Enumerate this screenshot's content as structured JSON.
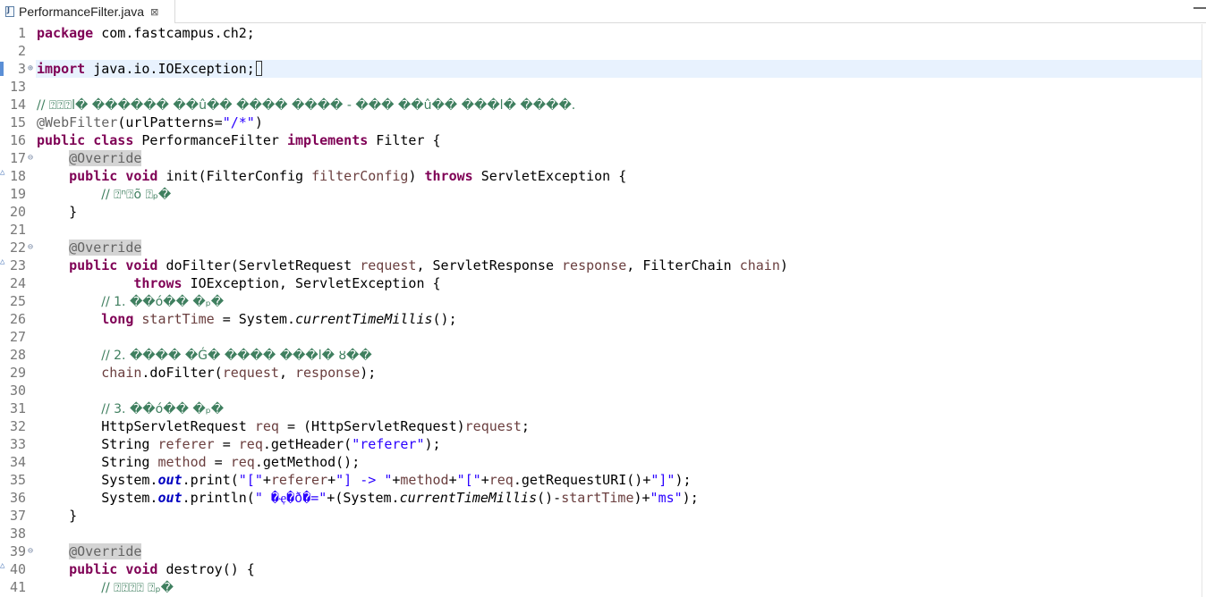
{
  "tab": {
    "title": "PerformanceFilter.java",
    "icon": "java-file-icon",
    "close_glyph": "⊠"
  },
  "colors": {
    "keyword": "#7f0055",
    "string": "#2a00ff",
    "comment": "#3f7f5f",
    "annotation": "#646464",
    "parameter": "#6a3e3e",
    "static_field": "#0000c0",
    "current_line": "#e8f2fe"
  },
  "lines": {
    "n1": "1",
    "n2": "2",
    "n3": "3",
    "n13": "13",
    "n14": "14",
    "n15": "15",
    "n16": "16",
    "n17": "17",
    "n18": "18",
    "n19": "19",
    "n20": "20",
    "n21": "21",
    "n22": "22",
    "n23": "23",
    "n24": "24",
    "n25": "25",
    "n26": "26",
    "n27": "27",
    "n28": "28",
    "n29": "29",
    "n30": "30",
    "n31": "31",
    "n32": "32",
    "n33": "33",
    "n34": "34",
    "n35": "35",
    "n36": "36",
    "n37": "37",
    "n38": "38",
    "n39": "39",
    "n40": "40",
    "n41": "41"
  },
  "code": {
    "l1_kw": "package",
    "l1_rest": " com.fastcampus.ch2;",
    "l3_kw": "import",
    "l3_rest": " java.io.IOException;",
    "l14_comment": "// ⍰⍰⍰l� ������ ��û�� ���� ���� - ��� ��û�� ���l� ����.",
    "l15_ann": "@WebFilter",
    "l15_a": "(urlPatterns=",
    "l15_s": "\"/*\"",
    "l15_b": ")",
    "l16_kw1": "public",
    "l16_kw2": "class",
    "l16_name": " PerformanceFilter ",
    "l16_kw3": "implements",
    "l16_rest": " Filter {",
    "override": "@Override",
    "l18_kw1": "public",
    "l18_kw2": "void",
    "l18_a": " init(FilterConfig ",
    "l18_p": "filterConfig",
    "l18_b": ") ",
    "l18_kw3": "throws",
    "l18_c": " ServletException {",
    "l19_comment": "// ⍰ⁿ⍰õ ⍰ₚ�",
    "close_brace": "}",
    "l23_kw1": "public",
    "l23_kw2": "void",
    "l23_a": " doFilter(ServletRequest ",
    "l23_p1": "request",
    "l23_b": ", ServletResponse ",
    "l23_p2": "response",
    "l23_c": ", FilterChain ",
    "l23_p3": "chain",
    "l23_d": ")",
    "l24_kw": "throws",
    "l24_rest": " IOException, ServletException {",
    "l25_comment": "// 1. ��ó�� �ₚ�",
    "l26_kw": "long",
    "l26_var": "startTime",
    "l26_a": " = System.",
    "l26_m": "currentTimeMillis",
    "l26_b": "();",
    "l28_comment": "// 2. ���� �Ǵ� ���� ���l� ȣ��",
    "l29_p1": "chain",
    "l29_a": ".doFilter(",
    "l29_p2": "request",
    "l29_b": ", ",
    "l29_p3": "response",
    "l29_c": ");",
    "l31_comment": "// 3. ��ó�� �ₚ�",
    "l32_a": "HttpServletRequest ",
    "l32_v": "req",
    "l32_b": " = (HttpServletRequest)",
    "l32_p": "request",
    "l32_c": ";",
    "l33_a": "String ",
    "l33_v": "referer",
    "l33_b": " = ",
    "l33_v2": "req",
    "l33_c": ".getHeader(",
    "l33_s": "\"referer\"",
    "l33_d": ");",
    "l34_a": "String ",
    "l34_v": "method",
    "l34_b": " = ",
    "l34_v2": "req",
    "l34_c": ".getMethod();",
    "l35_a": "System.",
    "l35_f": "out",
    "l35_b": ".print(",
    "l35_s1": "\"[\"",
    "l35_c": "+",
    "l35_v1": "referer",
    "l35_d": "+",
    "l35_s2": "\"] -> \"",
    "l35_e": "+",
    "l35_v2": "method",
    "l35_f2": "+",
    "l35_s3": "\"[\"",
    "l35_g": "+",
    "l35_v3": "req",
    "l35_h": ".getRequestURI()+",
    "l35_s4": "\"]\"",
    "l35_i": ");",
    "l36_a": "System.",
    "l36_f": "out",
    "l36_b": ".println(",
    "l36_s1": "\" �ҿ�ð�=\"",
    "l36_c": "+(System.",
    "l36_m": "currentTimeMillis",
    "l36_d": "()-",
    "l36_v": "startTime",
    "l36_e": ")+",
    "l36_s2": "\"ms\"",
    "l36_g": ");",
    "l40_kw1": "public",
    "l40_kw2": "void",
    "l40_rest": " destroy() {",
    "l41_comment": "// ⍰⍰⍰⍰ ⍰ₚ�"
  }
}
